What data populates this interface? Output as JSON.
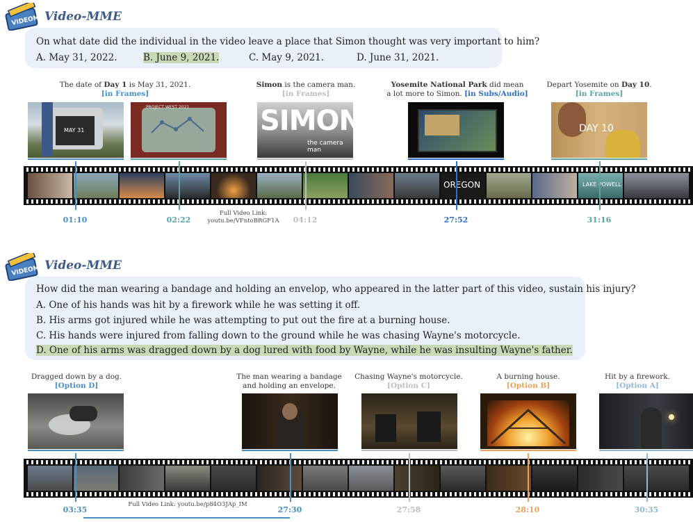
{
  "colors": {
    "blue": "#4a8fc4",
    "teal": "#5aa3a3",
    "gray": "#bdbdbd",
    "orange": "#e8a05a",
    "lightblue": "#8fb6d9",
    "darkblue": "#2f6fc6"
  },
  "panel1": {
    "title": "Video-MME",
    "logo_text": "VIDEOMME",
    "question": "On what date did the individual in the video leave a place that Simon thought was very important to him?",
    "options": [
      "A. May 31, 2022.",
      "B. June 9, 2021.",
      "C. May 9, 2021.",
      "D. June 31, 2021."
    ],
    "captions": [
      {
        "pre": "The date of ",
        "bold": "Day 1",
        "post": " is May 31, 2021.",
        "tag": "[in Frames]"
      },
      {
        "pre": "",
        "bold": "Simon",
        "post": " is the camera man.",
        "tag": "[in Frames]"
      },
      {
        "pre": "",
        "bold": "Yosemite National Park",
        "post": " did mean",
        "line2": "a lot more to Simon.",
        "tag": "[in Subs/Audio]"
      },
      {
        "pre": "Depart Yosemite on ",
        "bold": "Day 10",
        "post": ".",
        "tag": "[in Frames]"
      }
    ],
    "frame_texts": {
      "may": "MAY 31",
      "project": "PROJECT WEST 2021",
      "simon": "SIMON",
      "simon_sub": "the camera man",
      "day10": "DAY 10",
      "oregon": "OREGON",
      "lake": "LAKE POWELL"
    },
    "timestamps": [
      "01:10",
      "02:22",
      "04:12",
      "27:52",
      "31:16"
    ],
    "link_label": "Full Video Link:",
    "link_url": "youtu.be/VFntoBRGF1A"
  },
  "panel2": {
    "title": "Video-MME",
    "logo_text": "VIDEOMME",
    "question": "How did the man wearing a bandage and holding an envelop, who appeared in the latter part of this video, sustain his injury?",
    "options": [
      "A. One of his hands was hit by a firework while he was setting it off.",
      "B. His arms got injured while he was attempting to put out the fire at a burning house.",
      "C. His hands were injured from falling down to the ground while he was chasing Wayne's motorcycle.",
      "D. One of his arms was dragged down by a dog lured with food by Wayne, while he was insulting Wayne's father."
    ],
    "captions": [
      {
        "text": "Dragged down by a dog.",
        "tag": "[Option D]"
      },
      {
        "text": "The man wearing a bandage",
        "line2": "and holding an envelope.",
        "tag": ""
      },
      {
        "text": "Chasing Wayne's motorcycle.",
        "tag": "[Option C]"
      },
      {
        "text": "A burning house.",
        "tag": "[Option B]"
      },
      {
        "text": "Hit by a firework.",
        "tag": "[Option A]"
      }
    ],
    "timestamps": [
      "03:35",
      "27:30",
      "27:58",
      "28:10",
      "30:35"
    ],
    "link_text": "Full Video Link: youtu.be/p84O3JAp_IM"
  }
}
